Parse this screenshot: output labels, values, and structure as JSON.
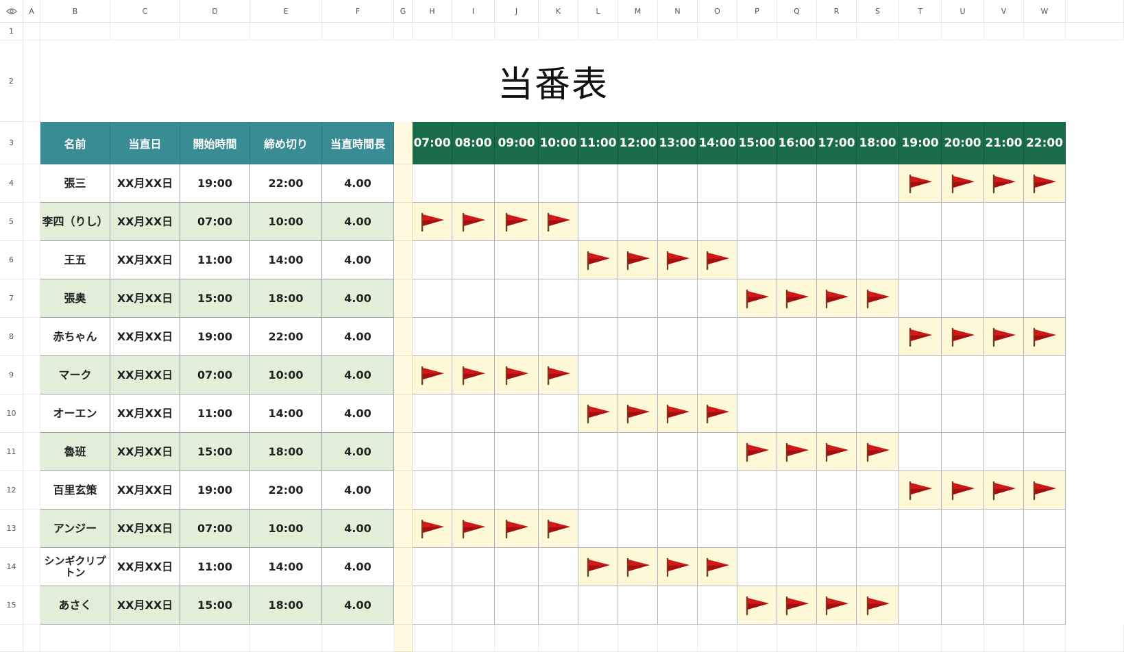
{
  "column_letters": [
    "A",
    "B",
    "C",
    "D",
    "E",
    "F",
    "G",
    "H",
    "I",
    "J",
    "K",
    "L",
    "M",
    "N",
    "O",
    "P",
    "Q",
    "R",
    "S",
    "T",
    "U",
    "V",
    "W"
  ],
  "row_numbers": [
    "1",
    "2",
    "3",
    "4",
    "5",
    "6",
    "7",
    "8",
    "9",
    "10",
    "11",
    "12",
    "13",
    "14",
    "15"
  ],
  "title": "当番表",
  "table_headers": [
    "名前",
    "当直日",
    "開始時間",
    "締め切り",
    "当直時間長"
  ],
  "hour_headers": [
    "07:00",
    "08:00",
    "09:00",
    "10:00",
    "11:00",
    "12:00",
    "13:00",
    "14:00",
    "15:00",
    "16:00",
    "17:00",
    "18:00",
    "19:00",
    "20:00",
    "21:00",
    "22:00"
  ],
  "rows": [
    {
      "name": "張三",
      "date": "XX月XX日",
      "start": "19:00",
      "end": "22:00",
      "hours": "4.00",
      "duty": [
        12,
        13,
        14,
        15
      ]
    },
    {
      "name": "李四（りし）",
      "date": "XX月XX日",
      "start": "07:00",
      "end": "10:00",
      "hours": "4.00",
      "duty": [
        0,
        1,
        2,
        3
      ]
    },
    {
      "name": "王五",
      "date": "XX月XX日",
      "start": "11:00",
      "end": "14:00",
      "hours": "4.00",
      "duty": [
        4,
        5,
        6,
        7
      ]
    },
    {
      "name": "張奥",
      "date": "XX月XX日",
      "start": "15:00",
      "end": "18:00",
      "hours": "4.00",
      "duty": [
        8,
        9,
        10,
        11
      ]
    },
    {
      "name": "赤ちゃん",
      "date": "XX月XX日",
      "start": "19:00",
      "end": "22:00",
      "hours": "4.00",
      "duty": [
        12,
        13,
        14,
        15
      ]
    },
    {
      "name": "マーク",
      "date": "XX月XX日",
      "start": "07:00",
      "end": "10:00",
      "hours": "4.00",
      "duty": [
        0,
        1,
        2,
        3
      ]
    },
    {
      "name": "オーエン",
      "date": "XX月XX日",
      "start": "11:00",
      "end": "14:00",
      "hours": "4.00",
      "duty": [
        4,
        5,
        6,
        7
      ]
    },
    {
      "name": "魯班",
      "date": "XX月XX日",
      "start": "15:00",
      "end": "18:00",
      "hours": "4.00",
      "duty": [
        8,
        9,
        10,
        11
      ]
    },
    {
      "name": "百里玄策",
      "date": "XX月XX日",
      "start": "19:00",
      "end": "22:00",
      "hours": "4.00",
      "duty": [
        12,
        13,
        14,
        15
      ]
    },
    {
      "name": "アンジー",
      "date": "XX月XX日",
      "start": "07:00",
      "end": "10:00",
      "hours": "4.00",
      "duty": [
        0,
        1,
        2,
        3
      ]
    },
    {
      "name": "シンギクリプトン",
      "date": "XX月XX日",
      "start": "11:00",
      "end": "14:00",
      "hours": "4.00",
      "duty": [
        4,
        5,
        6,
        7
      ]
    },
    {
      "name": "あさく",
      "date": "XX月XX日",
      "start": "15:00",
      "end": "18:00",
      "hours": "4.00",
      "duty": [
        8,
        9,
        10,
        11
      ]
    }
  ],
  "colors": {
    "header_teal": "#3a8c94",
    "header_green": "#1a6b4a",
    "row_alt_green": "#e2eed8",
    "duty_fill": "#fdf8d8",
    "flag_red": "#d01818"
  },
  "icons": {
    "corner": "eye-icon",
    "duty_marker": "red-flag-icon"
  }
}
